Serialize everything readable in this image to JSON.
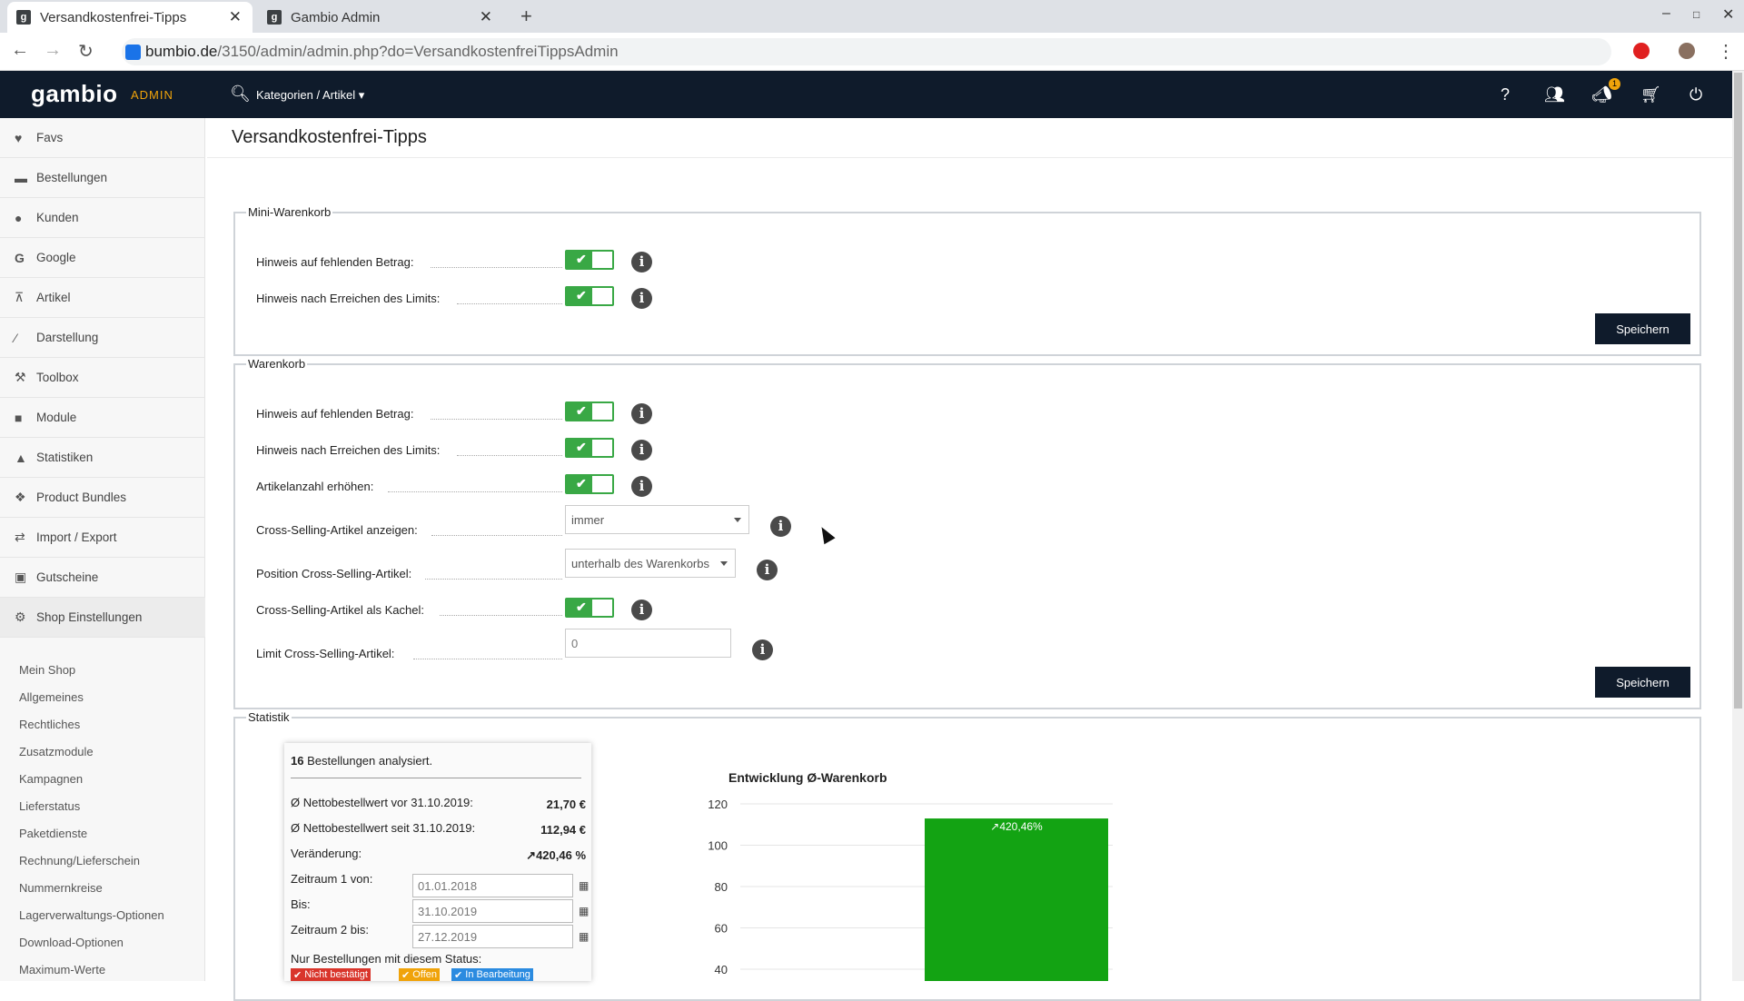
{
  "browser": {
    "tabs": [
      {
        "favicon": "g",
        "title": "Versandkostenfrei-Tipps",
        "active": true
      },
      {
        "favicon": "g",
        "title": "Gambio Admin",
        "active": false
      }
    ],
    "new_tab": "+",
    "url_host": "bumbio.de",
    "url_path": "/3150/admin/admin.php?do=VersandkostenfreiTippsAdmin"
  },
  "header": {
    "logo": "gambio",
    "logo_sub": "ADMIN",
    "search_label": "Kategorien / Artikel ▾",
    "badge_count": "1"
  },
  "sidebar": {
    "items": [
      {
        "icon": "heart-icon",
        "label": "Favs"
      },
      {
        "icon": "cart-icon",
        "label": "Bestellungen"
      },
      {
        "icon": "users-icon",
        "label": "Kunden"
      },
      {
        "icon": "google-icon",
        "label": "Google"
      },
      {
        "icon": "sitemap-icon",
        "label": "Artikel"
      },
      {
        "icon": "magic-icon",
        "label": "Darstellung"
      },
      {
        "icon": "wrench-icon",
        "label": "Toolbox"
      },
      {
        "icon": "puzzle-icon",
        "label": "Module"
      },
      {
        "icon": "chart-icon",
        "label": "Statistiken"
      },
      {
        "icon": "cubes-icon",
        "label": "Product Bundles"
      },
      {
        "icon": "exchange-icon",
        "label": "Import / Export"
      },
      {
        "icon": "gift-icon",
        "label": "Gutscheine"
      },
      {
        "icon": "cogs-icon",
        "label": "Shop Einstellungen"
      }
    ],
    "subitems": [
      "Mein Shop",
      "Allgemeines",
      "Rechtliches",
      "Zusatzmodule",
      "Kampagnen",
      "Lieferstatus",
      "Paketdienste",
      "Rechnung/Lieferschein",
      "Nummernkreise",
      "Lagerverwaltungs-Optionen",
      "Download-Optionen",
      "Maximum-Werte"
    ]
  },
  "page_title": "Versandkostenfrei-Tipps",
  "mini_warenkorb": {
    "legend": "Mini-Warenkorb",
    "rows": [
      {
        "label": "Hinweis auf fehlenden Betrag:",
        "value": true
      },
      {
        "label": "Hinweis nach Erreichen des Limits:",
        "value": true
      }
    ],
    "save": "Speichern"
  },
  "warenkorb": {
    "legend": "Warenkorb",
    "rows": [
      {
        "label": "Hinweis auf fehlenden Betrag:",
        "value": true
      },
      {
        "label": "Hinweis nach Erreichen des Limits:",
        "value": true
      },
      {
        "label": "Artikelanzahl erhöhen:",
        "value": true
      },
      {
        "label": "Cross-Selling-Artikel anzeigen:",
        "value": "immer"
      },
      {
        "label": "Position Cross-Selling-Artikel:",
        "value": "unterhalb des Warenkorbs"
      },
      {
        "label": "Cross-Selling-Artikel als Kachel:",
        "value": true
      },
      {
        "label": "Limit Cross-Selling-Artikel:",
        "value": "0"
      }
    ],
    "save": "Speichern"
  },
  "statistik": {
    "legend": "Statistik",
    "count": "16",
    "count_text": "Bestellungen analysiert.",
    "lines": [
      {
        "label": "Ø Nettobestellwert vor 31.10.2019:",
        "value": "21,70 €"
      },
      {
        "label": "Ø Nettobestellwert seit 31.10.2019:",
        "value": "112,94 €"
      },
      {
        "label": "Veränderung:",
        "value": "↗420,46 %"
      }
    ],
    "dates": [
      {
        "label": "Zeitraum 1 von:",
        "value": "01.01.2018"
      },
      {
        "label": "Bis:",
        "value": "31.10.2019"
      },
      {
        "label": "Zeitraum 2 bis:",
        "value": "27.12.2019"
      }
    ],
    "status_label": "Nur Bestellungen mit diesem Status:",
    "status_tags": [
      {
        "label": "Nicht bestätigt",
        "color": "#d9352b"
      },
      {
        "label": "Offen",
        "color": "#f0a30a"
      },
      {
        "label": "In Bearbeitung",
        "color": "#2b8be0"
      }
    ]
  },
  "chart_data": {
    "type": "bar",
    "title": "Entwicklung Ø-Warenkorb",
    "yticks": [
      120,
      100,
      80,
      60,
      40
    ],
    "ylim": [
      40,
      120
    ],
    "bars": [
      {
        "value": 112.94,
        "label": "↗420,46%",
        "color": "#13a313"
      }
    ]
  }
}
